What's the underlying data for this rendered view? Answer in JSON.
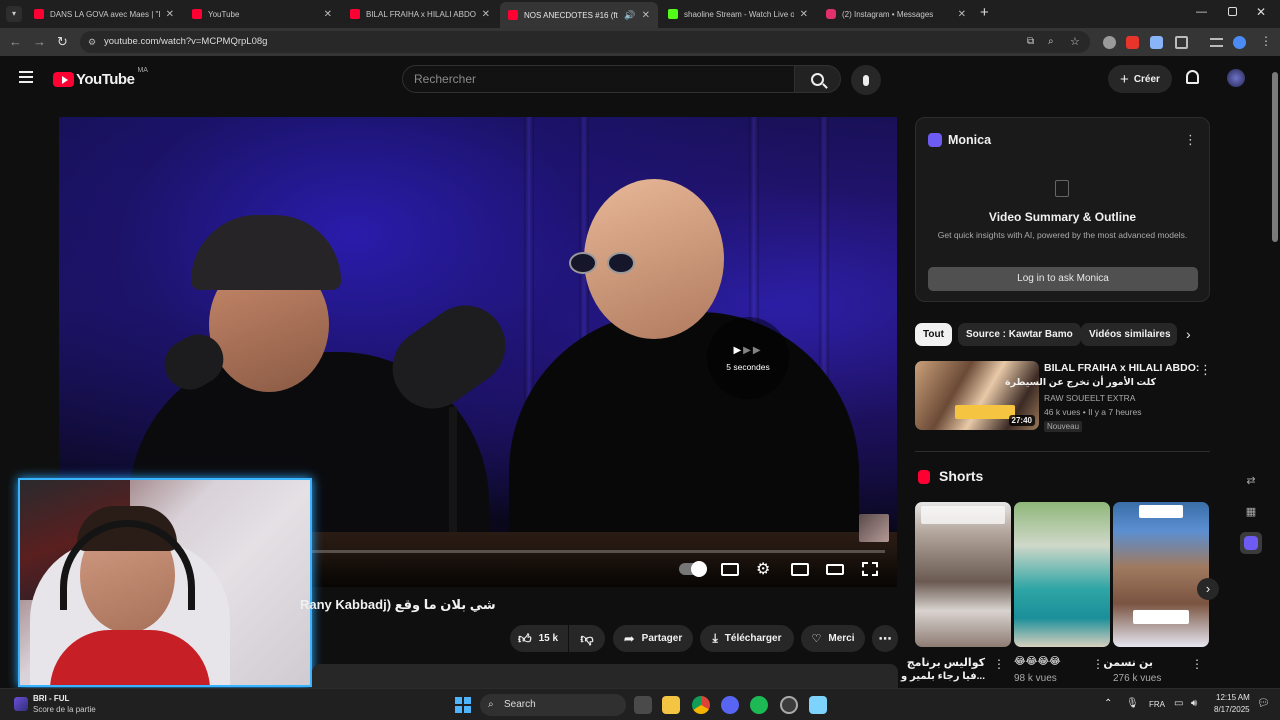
{
  "browser": {
    "tabs": [
      {
        "title": "DANS LA GOVA avec Maes | \"Le",
        "active": false,
        "favicon_color": "#ff0033"
      },
      {
        "title": "YouTube",
        "active": false,
        "favicon_color": "#ff0033"
      },
      {
        "title": "BILAL FRAIHA x HILALI ABDO: ",
        "active": false,
        "favicon_color": "#ff0033"
      },
      {
        "title": "NOS ANECDOTES #16 (ft Fa",
        "active": true,
        "favicon_color": "#ff0033"
      },
      {
        "title": "shaoline Stream - Watch Live o",
        "active": false,
        "favicon_color": "#53fc18"
      },
      {
        "title": "(2) Instagram • Messages",
        "active": false,
        "favicon_color": "#e1306c"
      }
    ],
    "new_tab_label": "+",
    "url": "youtube.com/watch?v=MCPMQrpL08g"
  },
  "youtube": {
    "logo_text": "YouTube",
    "region": "MA",
    "search_placeholder": "Rechercher",
    "create_label": "Créer",
    "colors": {
      "brand": "#ff0033",
      "background": "#0f0f0f",
      "progress": "#ff0000"
    }
  },
  "player": {
    "skip_label": "5 secondes",
    "progress": 0.0
  },
  "video": {
    "title": "شي بلان ما وقع (Rany Kabbadj",
    "likes": "15 k",
    "share_label": "Partager",
    "download_label": "Télécharger",
    "thanks_label": "Merci"
  },
  "monica": {
    "name": "Monica",
    "heading": "Video Summary & Outline",
    "subtitle": "Get quick insights with AI, powered by the most advanced models.",
    "login_label": "Log in to ask Monica"
  },
  "chips": [
    "Tout",
    "Source : Kawtar Bamo",
    "Vidéos similaires"
  ],
  "recommended": {
    "title": "BILAL FRAIHA x HILALI ABDO:",
    "subtitle": "كلت الأمور أن تخرج عن السيطرة",
    "channel": "RAW SOUEELT EXTRA",
    "meta": "46 k vues • Il y a 7 heures",
    "badge": "Nouveau",
    "duration": "27:40"
  },
  "shorts": {
    "heading": "Shorts",
    "items": [
      {
        "title": "كواليس برنامج",
        "title2": "...فيا رجاء بلمير و",
        "views": ""
      },
      {
        "title": "😂😂😂😂",
        "views": "98 k vues"
      },
      {
        "title": "بن نسمن",
        "views": "276 k vues"
      }
    ]
  },
  "taskbar": {
    "game_title": "BRI - FUL",
    "game_subtitle": "Score de la partie",
    "search_label": "Search",
    "language": "FRA",
    "time": "12:15 AM",
    "date": "8/17/2025"
  }
}
